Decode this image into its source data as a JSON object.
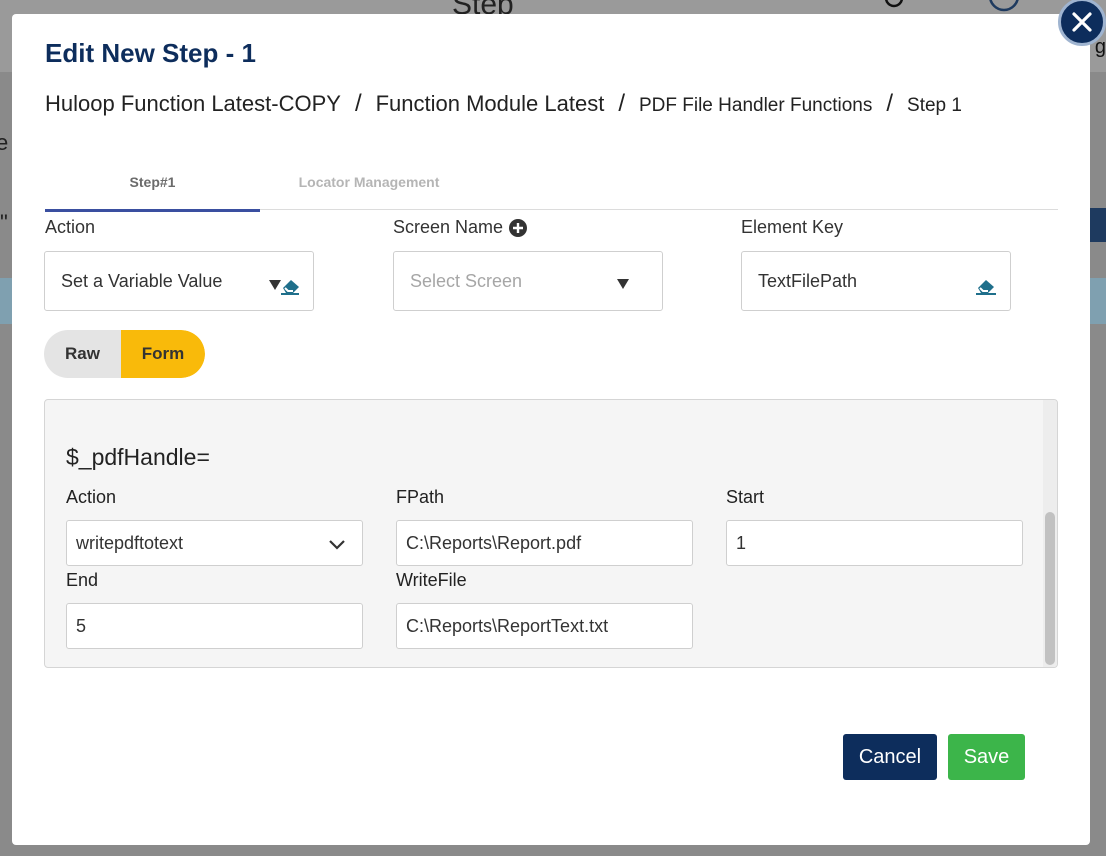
{
  "background": {
    "title": "Step",
    "side_text": "e l",
    "side_quote": "\"",
    "corner_letter": "g"
  },
  "modal": {
    "title": "Edit New Step - 1",
    "close_icon": "close-icon",
    "breadcrumb": [
      "Huloop Function Latest-COPY",
      "Function Module Latest",
      "PDF File Handler Functions",
      "Step 1"
    ],
    "breadcrumb_separator": "/",
    "tabs": [
      "Step#1",
      "Locator Management"
    ],
    "active_tab": "Step#1"
  },
  "fields": {
    "action": {
      "label": "Action",
      "value": "Set a Variable Value"
    },
    "screen_name": {
      "label": "Screen Name",
      "placeholder": "Select Screen"
    },
    "element_key": {
      "label": "Element Key",
      "value": "TextFilePath"
    }
  },
  "toggle": {
    "raw_label": "Raw",
    "form_label": "Form",
    "selected": "Form"
  },
  "form_panel": {
    "heading": "$_pdfHandle=",
    "action": {
      "label": "Action",
      "value": "writepdftotext"
    },
    "fpath": {
      "label": "FPath",
      "value": "C:\\Reports\\Report.pdf"
    },
    "start": {
      "label": "Start",
      "value": "1"
    },
    "end": {
      "label": "End",
      "value": "5"
    },
    "writefile": {
      "label": "WriteFile",
      "value": "C:\\Reports\\ReportText.txt"
    }
  },
  "buttons": {
    "cancel": "Cancel",
    "save": "Save"
  },
  "colors": {
    "primary": "#0d2d5c",
    "accent_yellow": "#f9ba0a",
    "save_green": "#3cb54a",
    "tab_underline": "#3a4fa0"
  }
}
